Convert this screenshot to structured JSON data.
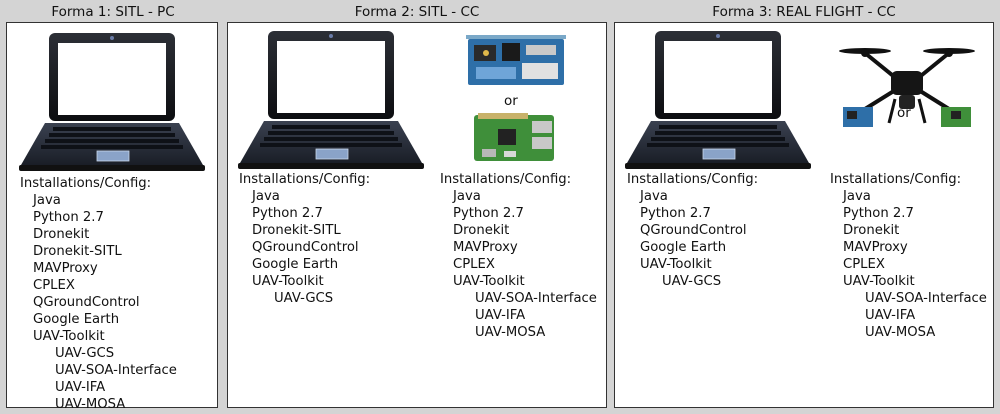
{
  "forms": [
    {
      "title": "Forma 1: SITL - PC",
      "configs": [
        {
          "header": "Installations/Config:",
          "items": [
            {
              "text": "Java",
              "level": 1
            },
            {
              "text": "Python 2.7",
              "level": 1
            },
            {
              "text": "Dronekit",
              "level": 1
            },
            {
              "text": "Dronekit-SITL",
              "level": 1
            },
            {
              "text": "MAVProxy",
              "level": 1
            },
            {
              "text": "CPLEX",
              "level": 1
            },
            {
              "text": "QGroundControl",
              "level": 1
            },
            {
              "text": "Google Earth",
              "level": 1
            },
            {
              "text": "UAV-Toolkit",
              "level": 1
            },
            {
              "text": "UAV-GCS",
              "level": 2
            },
            {
              "text": "UAV-SOA-Interface",
              "level": 2
            },
            {
              "text": "UAV-IFA",
              "level": 2
            },
            {
              "text": "UAV-MOSA",
              "level": 2
            }
          ]
        }
      ]
    },
    {
      "title": "Forma 2: SITL - CC",
      "or_label": "or",
      "configs": [
        {
          "header": "Installations/Config:",
          "items": [
            {
              "text": "Java",
              "level": 1
            },
            {
              "text": "Python 2.7",
              "level": 1
            },
            {
              "text": "Dronekit-SITL",
              "level": 1
            },
            {
              "text": "QGroundControl",
              "level": 1
            },
            {
              "text": "Google Earth",
              "level": 1
            },
            {
              "text": "UAV-Toolkit",
              "level": 1
            },
            {
              "text": "UAV-GCS",
              "level": 2
            }
          ]
        },
        {
          "header": "Installations/Config:",
          "items": [
            {
              "text": "Java",
              "level": 1
            },
            {
              "text": "Python 2.7",
              "level": 1
            },
            {
              "text": "Dronekit",
              "level": 1
            },
            {
              "text": "MAVProxy",
              "level": 1
            },
            {
              "text": "CPLEX",
              "level": 1
            },
            {
              "text": "UAV-Toolkit",
              "level": 1
            },
            {
              "text": "UAV-SOA-Interface",
              "level": 2
            },
            {
              "text": "UAV-IFA",
              "level": 2
            },
            {
              "text": "UAV-MOSA",
              "level": 2
            }
          ]
        }
      ]
    },
    {
      "title": "Forma 3: REAL FLIGHT - CC",
      "or_label": "or",
      "configs": [
        {
          "header": "Installations/Config:",
          "items": [
            {
              "text": "Java",
              "level": 1
            },
            {
              "text": "Python 2.7",
              "level": 1
            },
            {
              "text": "QGroundControl",
              "level": 1
            },
            {
              "text": "Google Earth",
              "level": 1
            },
            {
              "text": "UAV-Toolkit",
              "level": 1
            },
            {
              "text": "UAV-GCS",
              "level": 2
            }
          ]
        },
        {
          "header": "Installations/Config:",
          "items": [
            {
              "text": "Java",
              "level": 1
            },
            {
              "text": "Python 2.7",
              "level": 1
            },
            {
              "text": "Dronekit",
              "level": 1
            },
            {
              "text": "MAVProxy",
              "level": 1
            },
            {
              "text": "CPLEX",
              "level": 1
            },
            {
              "text": "UAV-Toolkit",
              "level": 1
            },
            {
              "text": "UAV-SOA-Interface",
              "level": 2
            },
            {
              "text": "UAV-IFA",
              "level": 2
            },
            {
              "text": "UAV-MOSA",
              "level": 2
            }
          ]
        }
      ]
    }
  ]
}
